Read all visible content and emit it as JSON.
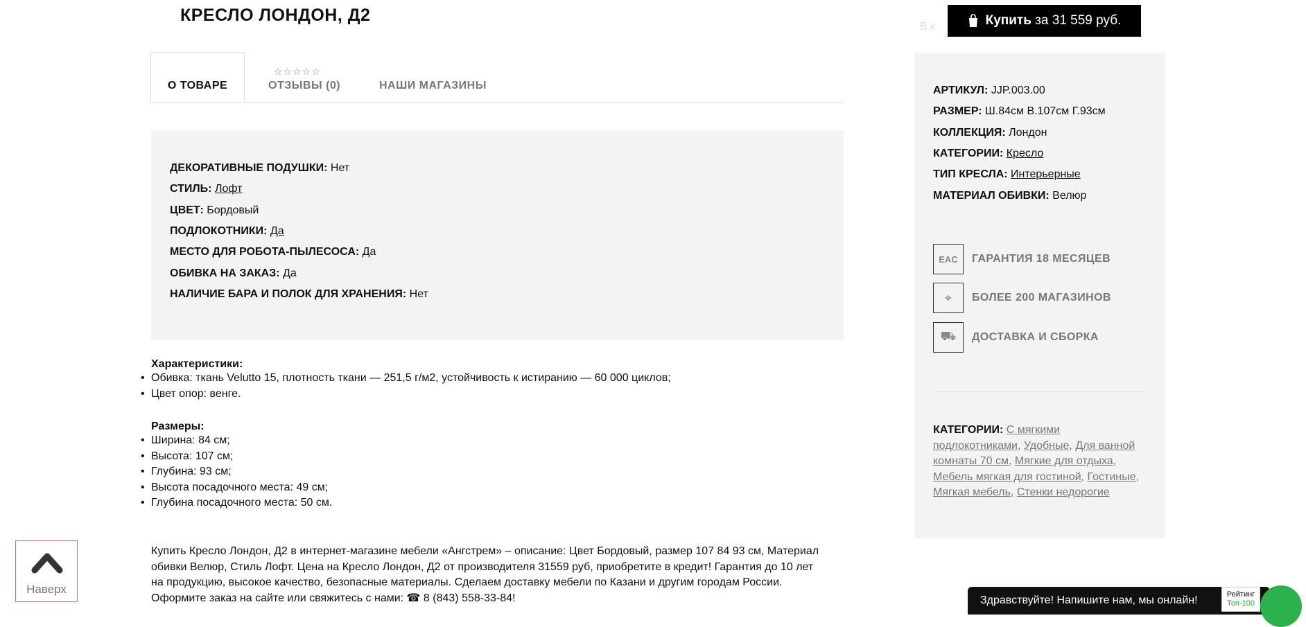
{
  "product": {
    "title": "КРЕСЛО ЛОНДОН, Д2"
  },
  "tabs": {
    "about": "О ТОВАРЕ",
    "reviews": "ОТЗЫВЫ (0)",
    "reviews_stars": "☆☆☆☆☆",
    "shops": "НАШИ МАГАЗИНЫ"
  },
  "props": [
    {
      "label": "ДЕКОРАТИВНЫЕ ПОДУШКИ:",
      "value": "Нет"
    },
    {
      "label": "СТИЛЬ:",
      "value": "Лофт"
    },
    {
      "label": "ЦВЕТ:",
      "value": "Бордовый"
    },
    {
      "label": "ПОДЛОКОТНИКИ:",
      "value": "Да"
    },
    {
      "label": "МЕСТО ДЛЯ РОБОТА-ПЫЛЕСОСА:",
      "value": "Да"
    },
    {
      "label": "ОБИВКА НА ЗАКАЗ:",
      "value": "Да"
    },
    {
      "label": "НАЛИЧИЕ БАРА И ПОЛОК ДЛЯ ХРАНЕНИЯ:",
      "value": "Нет"
    }
  ],
  "characteristics": {
    "heading": "Характеристики:",
    "items": [
      "Обивка: ткань Velutto 15, плотность ткани — 251,5 г/м2, устойчивость к истиранию — 60 000 циклов;",
      "Цвет опор: венге."
    ]
  },
  "sizes": {
    "heading": "Размеры:",
    "items": [
      "Ширина: 84 см;",
      "Высота: 107 см;",
      "Глубина: 93 см;",
      "Высота посадочного места: 49 см;",
      "Глубина посадочного места: 50 см."
    ]
  },
  "description": "Купить Кресло Лондон, Д2 в интернет-магазине мебели «Ангстрем» – описание: Цвет Бордовый, размер 107 84 93 см, Материал обивки Велюр, Стиль Лофт. Цена на Кресло Лондон, Д2 от производителя 31559 руб, приобретите в кредит! Гарантия до 10 лет на продукцию, высокое качество, безопасные материалы. Сделаем доставку мебели по Казани и другим городам России. Оформите заказ на сайте или свяжитесь с нами: ☎ 8 (843) 558-33-84!",
  "buy": {
    "label_bold": "Купить",
    "label_rest": "за 31 559 руб.",
    "behind_text": "В к"
  },
  "sidebar": {
    "specs": [
      {
        "label": "АРТИКУЛ:",
        "value": "JJP.003.00"
      },
      {
        "label": "РАЗМЕР:",
        "value": "Ш.84см В.107см Г.93см"
      },
      {
        "label": "КОЛЛЕКЦИЯ:",
        "value": "Лондон"
      },
      {
        "label": "КАТЕГОРИИ:",
        "value": "Кресло"
      },
      {
        "label": "ТИП КРЕСЛА:",
        "value": "Интерьерные"
      },
      {
        "label": "МАТЕРИАЛ ОБИВКИ:",
        "value": "Велюр"
      }
    ],
    "features": [
      {
        "icon": "eac-icon",
        "glyph": "EAC",
        "text": "ГАРАНТИЯ 18 МЕСЯЦЕВ"
      },
      {
        "icon": "location-pin-icon",
        "glyph": "⌖",
        "text": "БОЛЕЕ 200 МАГАЗИНОВ"
      },
      {
        "icon": "delivery-truck-icon",
        "glyph": "⛟",
        "text": "ДОСТАВКА И СБОРКА"
      }
    ],
    "categories_label": "КАТЕГОРИИ:",
    "categories": [
      "С мягкими подлокотниками",
      "Удобные",
      "Для ванной комнаты 70 см",
      "Мягкие для отдыха",
      "Мебель мягкая для гостиной",
      "Гостиные",
      "Мягкая мебель",
      "Стенки недорогие"
    ]
  },
  "up_button": {
    "label": "Наверх"
  },
  "chat": {
    "text": "Здравствуйте! Напишите нам, мы онлайн!"
  },
  "rating_badge": {
    "title": "Рейтинг",
    "subtitle": "Топ-100"
  },
  "colors": {
    "accent": "#000000",
    "panel": "#f3f3f3",
    "chat_green": "#2bb24c"
  }
}
